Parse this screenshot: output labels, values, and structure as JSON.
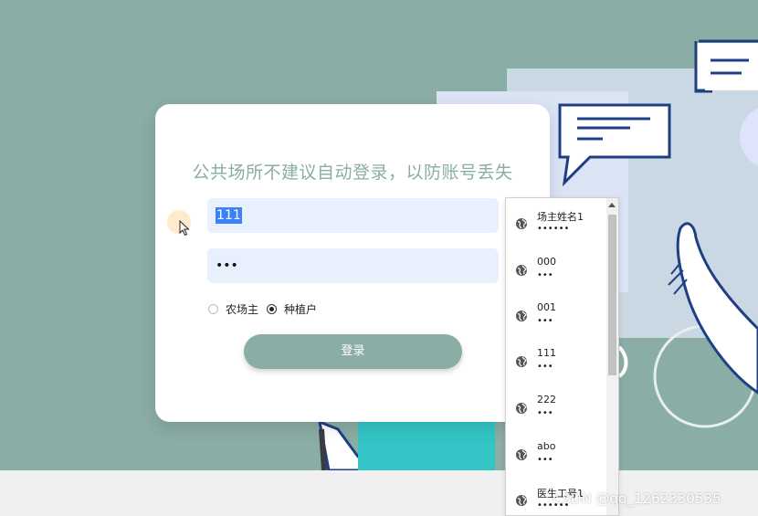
{
  "login": {
    "notice": "公共场所不建议自动登录，以防账号丢失",
    "username_value": "111",
    "password_dots": "•••",
    "roles": [
      {
        "label": "农场主",
        "checked": false
      },
      {
        "label": "种植户",
        "checked": true
      }
    ],
    "submit_label": "登录"
  },
  "autocomplete": {
    "items": [
      {
        "username": "场主姓名1",
        "password": "••••••"
      },
      {
        "username": "000",
        "password": "•••"
      },
      {
        "username": "001",
        "password": "•••"
      },
      {
        "username": "111",
        "password": "•••"
      },
      {
        "username": "222",
        "password": "•••"
      },
      {
        "username": "abo",
        "password": "•••"
      },
      {
        "username": "医生工号1",
        "password": "••••••"
      }
    ]
  },
  "watermark": "CSDN @qq_1262330535",
  "colors": {
    "background": "#8aada5",
    "accent": "#8aada5",
    "input_fill": "#e8f0fe",
    "illustration_navy": "#1f3f85"
  }
}
